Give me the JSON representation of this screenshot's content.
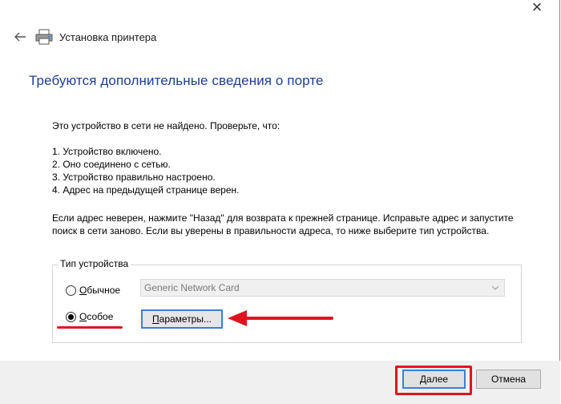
{
  "window": {
    "title": "Установка принтера"
  },
  "heading": "Требуются дополнительные сведения о порте",
  "message": {
    "intro": "Это устройство в сети не найдено. Проверьте, что:",
    "steps": [
      "1.  Устройство включено.",
      "2.  Оно соединено с сетью.",
      "3.  Устройство правильно настроено.",
      "4.  Адрес на предыдущей странице верен."
    ],
    "paragraph": "Если адрес неверен, нажмите \"Назад\" для возврата к прежней странице.  Исправьте адрес и запустите поиск в сети заново.  Если вы уверены в правильности адреса, то ниже выберите тип устройства."
  },
  "device_type": {
    "legend": "Тип устройства",
    "option_standard": {
      "accel": "О",
      "rest": "бычное",
      "selected": false
    },
    "option_custom": {
      "accel": "О",
      "rest": "собое",
      "selected": true
    },
    "standard_combo_value": "Generic Network Card",
    "params_button": {
      "accel": "П",
      "rest": "араметры..."
    }
  },
  "footer": {
    "next_label": "Далее",
    "cancel_label": "Отмена"
  },
  "colors": {
    "heading": "#1c3f94",
    "annotation_red": "#e0141f",
    "focus_blue": "#3c7fd8"
  },
  "icons": {
    "close": "close-icon",
    "back": "back-arrow-icon",
    "printer": "printer-icon",
    "combo": "chevron-down-icon"
  }
}
